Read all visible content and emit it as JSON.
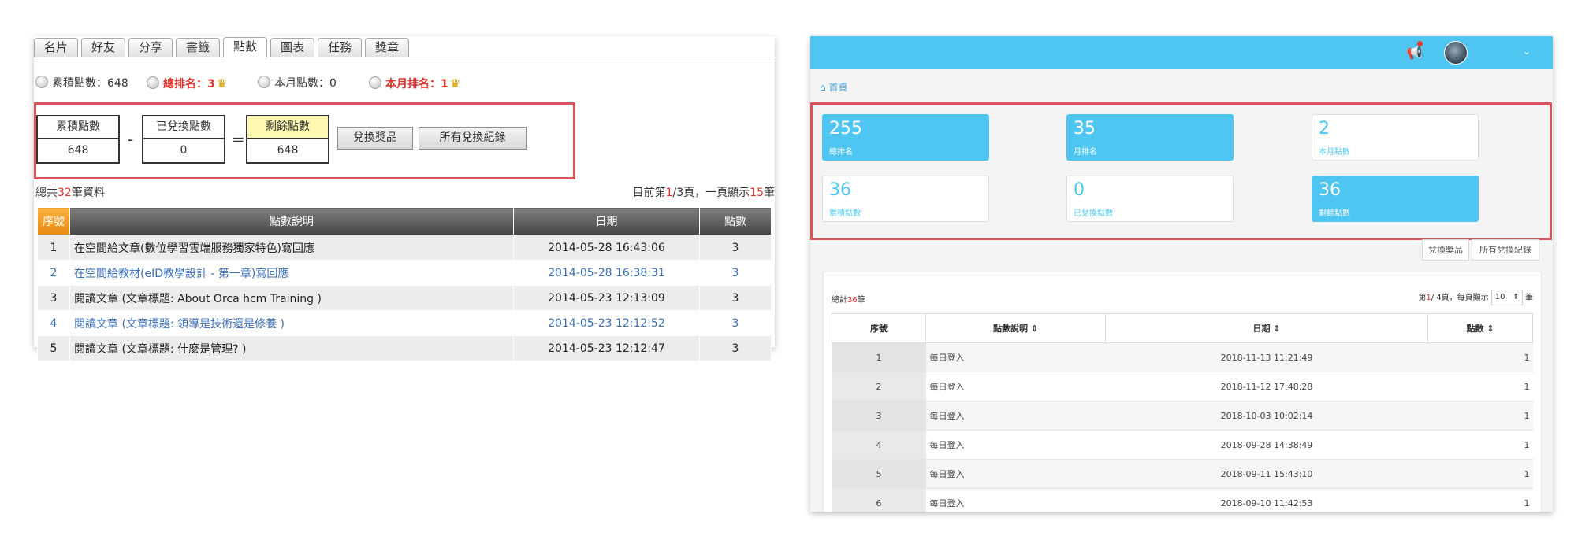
{
  "old_ui": {
    "tabs": [
      "名片",
      "好友",
      "分享",
      "書籤",
      "點數",
      "圖表",
      "任務",
      "獎章"
    ],
    "active_tab": "點數",
    "stats": [
      {
        "label": "累積點數：648",
        "highlight": false,
        "crown": false
      },
      {
        "label": "總排名：3",
        "highlight": true,
        "crown": true
      },
      {
        "label": "本月點數：0",
        "highlight": false,
        "crown": false
      },
      {
        "label": "本月排名：1",
        "highlight": true,
        "crown": true
      }
    ],
    "formula": {
      "accumulated_label": "累積點數",
      "accumulated_value": "648",
      "minus": "-",
      "redeemed_label": "已兌換點數",
      "redeemed_value": "0",
      "equals": "=",
      "remaining_label": "剩餘點數",
      "remaining_value": "648",
      "redeem_button": "兌換獎品",
      "history_button": "所有兌換紀錄"
    },
    "total": {
      "prefix": "總共",
      "count": "32",
      "suffix": "筆資料"
    },
    "paging": {
      "prefix": "目前第",
      "current": "1",
      "middle": "/3頁，一頁顯示",
      "per_page": "15",
      "suffix": "筆"
    },
    "table": {
      "headers": [
        "序號",
        "點數說明",
        "日期",
        "點數"
      ],
      "rows": [
        {
          "seq": "1",
          "desc": "在空間給文章(數位學習雲端服務獨家特色)寫回應",
          "date": "2014-05-28 16:43:06",
          "pts": "3"
        },
        {
          "seq": "2",
          "desc": "在空間給教材(eID教學設計 - 第一章)寫回應",
          "date": "2014-05-28 16:38:31",
          "pts": "3"
        },
        {
          "seq": "3",
          "desc": "閱讀文章 (文章標題: About Orca hcm Training )",
          "date": "2014-05-23 12:13:09",
          "pts": "3"
        },
        {
          "seq": "4",
          "desc": "閱讀文章 (文章標題: 領導是技術還是修養 )",
          "date": "2014-05-23 12:12:52",
          "pts": "3"
        },
        {
          "seq": "5",
          "desc": "閱讀文章 (文章標題: 什麼是管理? )",
          "date": "2014-05-23 12:12:47",
          "pts": "3"
        }
      ]
    }
  },
  "new_ui": {
    "breadcrumb": "首頁",
    "cards": [
      {
        "value": "255",
        "label": "總排名",
        "style": "blue"
      },
      {
        "value": "35",
        "label": "月排名",
        "style": "blue"
      },
      {
        "value": "2",
        "label": "本月點數",
        "style": "white"
      },
      {
        "value": "36",
        "label": "累積點數",
        "style": "white"
      },
      {
        "value": "0",
        "label": "已兌換點數",
        "style": "white"
      },
      {
        "value": "36",
        "label": "剩餘點數",
        "style": "blue"
      }
    ],
    "redeem_button": "兌換獎品",
    "history_button": "所有兌換紀錄",
    "total": {
      "prefix": "總計",
      "count": "36",
      "suffix": "筆"
    },
    "paging": {
      "prefix": "第",
      "current": "1",
      "middle": "/ 4頁，每頁顯示",
      "page_size": "10",
      "suffix": "筆"
    },
    "table": {
      "headers": [
        "序號",
        "點數說明 ⇕",
        "日期 ⇕",
        "點數 ⇕"
      ],
      "rows": [
        {
          "seq": "1",
          "desc": "每日登入",
          "date": "2018-11-13 11:21:49",
          "pts": "1"
        },
        {
          "seq": "2",
          "desc": "每日登入",
          "date": "2018-11-12 17:48:28",
          "pts": "1"
        },
        {
          "seq": "3",
          "desc": "每日登入",
          "date": "2018-10-03 10:02:14",
          "pts": "1"
        },
        {
          "seq": "4",
          "desc": "每日登入",
          "date": "2018-09-28 14:38:49",
          "pts": "1"
        },
        {
          "seq": "5",
          "desc": "每日登入",
          "date": "2018-09-11 15:43:10",
          "pts": "1"
        },
        {
          "seq": "6",
          "desc": "每日登入",
          "date": "2018-09-10 11:42:53",
          "pts": "1"
        }
      ]
    },
    "colors": {
      "accent": "#4ec6f1",
      "highlight_border": "#d9555b",
      "notify_dot": "#e8392e"
    }
  }
}
